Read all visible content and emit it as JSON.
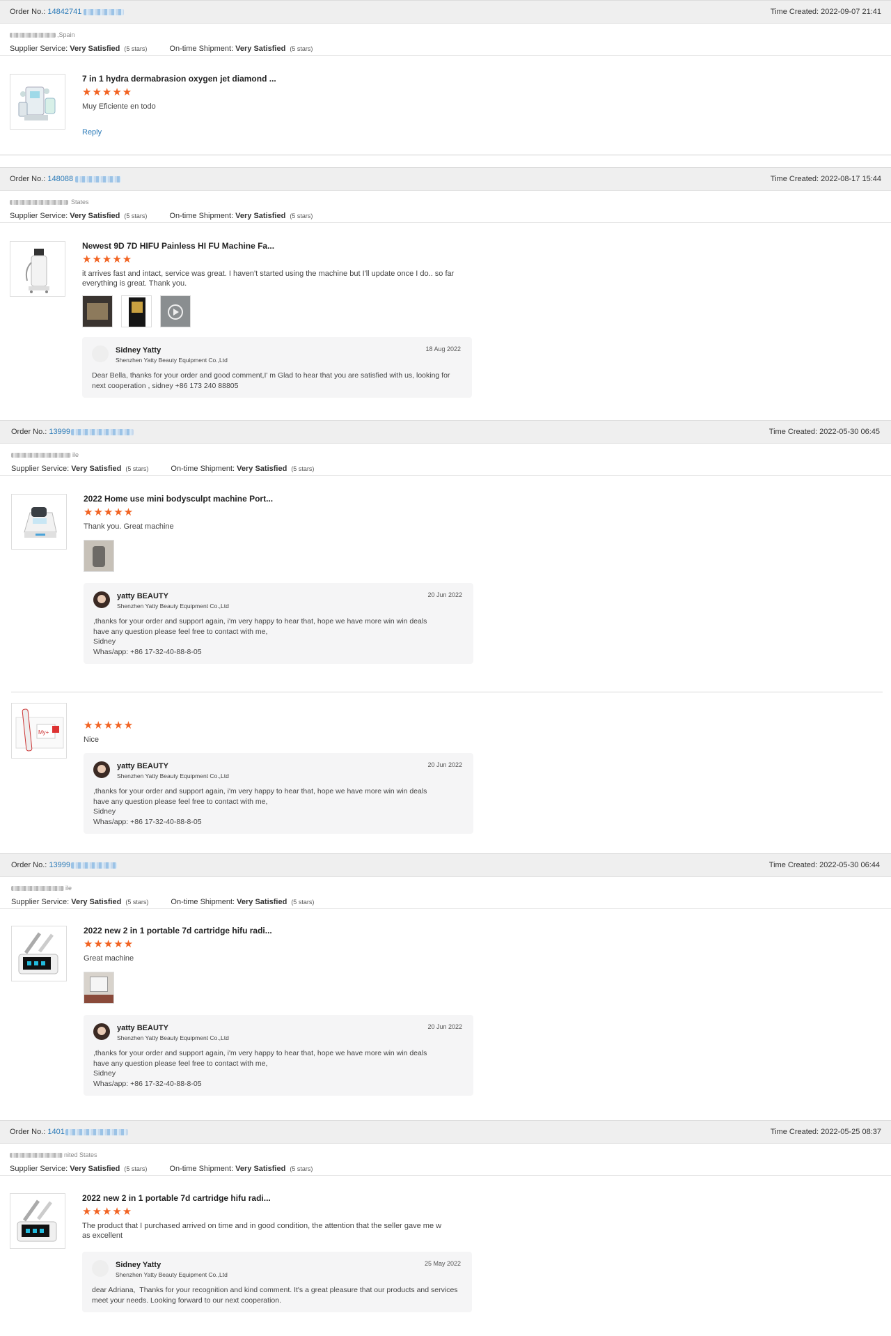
{
  "labels": {
    "order_no": "Order No.:",
    "time_created": "Time Created:",
    "supplier_service": "Supplier Service:",
    "ontime_shipment": "On-time Shipment:",
    "very_satisfied": "Very Satisfied",
    "five_stars": "(5 stars)",
    "reply": "Reply",
    "stars": "★★★★★"
  },
  "orders": [
    {
      "order_no_visible": "14842741",
      "time_created": "2022-09-07 21:41",
      "buyer_suffix": ",Spain",
      "reviews": [
        {
          "product": "7 in 1 hydra dermabrasion oxygen jet diamond ...",
          "rating": 5,
          "comment": "Muy Eficiente en todo",
          "photos": 0
        }
      ]
    },
    {
      "order_no_visible": "148088",
      "time_created": "2022-08-17 15:44",
      "buyer_suffix": "States",
      "reviews": [
        {
          "product": "Newest 9D 7D HIFU Painless HI FU Machine Fa...",
          "rating": 5,
          "comment": "it arrives fast and intact, service was great. I haven't started using the machine but I'll update once I do.. so far everything is great. Thank you.",
          "photos": 3,
          "reply": {
            "name": "Sidney Yatty",
            "company": "Shenzhen Yatty Beauty Equipment Co.,Ltd",
            "date": "18 Aug 2022",
            "text": "Dear Bella, thanks for your order and good comment,I' m Glad to hear that you are satisfied with us, looking for next cooperation , sidney +86 173 240 88805"
          }
        }
      ]
    },
    {
      "order_no_visible": "13999",
      "time_created": "2022-05-30 06:45",
      "buyer_suffix": "ile",
      "reviews": [
        {
          "product": "2022 Home use mini bodysculpt machine Port...",
          "rating": 5,
          "comment": "Thank you. Great machine",
          "photos": 1,
          "reply": {
            "name": "yatty BEAUTY",
            "company": "Shenzhen Yatty Beauty Equipment Co.,Ltd",
            "date": "20 Jun 2022",
            "text": ",thanks for your order and support again, i'm  very happy to hear that, hope we have more win win deals\nhave any question please feel free to contact with me,\nSidney\nWhas/app: +86 17-32-40-88-8-05"
          }
        },
        {
          "product": "",
          "rating": 5,
          "comment": "Nice",
          "photos": 0,
          "reply": {
            "name": "yatty BEAUTY",
            "company": "Shenzhen Yatty Beauty Equipment Co.,Ltd",
            "date": "20 Jun 2022",
            "text": ",thanks for your order and support again, i'm  very happy to hear that, hope we have more win win deals\nhave any question please feel free to contact with me,\nSidney\nWhas/app: +86 17-32-40-88-8-05"
          }
        }
      ]
    },
    {
      "order_no_visible": "13999",
      "time_created": "2022-05-30 06:44",
      "buyer_suffix": "ile",
      "reviews": [
        {
          "product": "2022 new 2 in 1 portable 7d cartridge hifu radi...",
          "rating": 5,
          "comment": "Great machine",
          "photos": 1,
          "reply": {
            "name": "yatty BEAUTY",
            "company": "Shenzhen Yatty Beauty Equipment Co.,Ltd",
            "date": "20 Jun 2022",
            "text": ",thanks for your order and support again, i'm  very happy to hear that, hope we have more win win deals\nhave any question please feel free to contact with me,\nSidney\nWhas/app: +86 17-32-40-88-8-05"
          }
        }
      ]
    },
    {
      "order_no_visible": "1401",
      "time_created": "2022-05-25 08:37",
      "buyer_suffix": "nited States",
      "reviews": [
        {
          "product": "2022 new 2 in 1 portable 7d cartridge hifu radi...",
          "rating": 5,
          "comment": "The product that I purchased arrived on time and in good condition, the attention that the seller gave me w as excellent",
          "photos": 0,
          "reply": {
            "name": "Sidney Yatty",
            "company": "Shenzhen Yatty Beauty Equipment Co.,Ltd",
            "date": "25 May 2022",
            "text": "dear Adriana,  Thanks for your recognition and kind comment. It's a great pleasure that our products and services meet your needs. Looking forward to our next cooperation."
          }
        }
      ]
    }
  ]
}
